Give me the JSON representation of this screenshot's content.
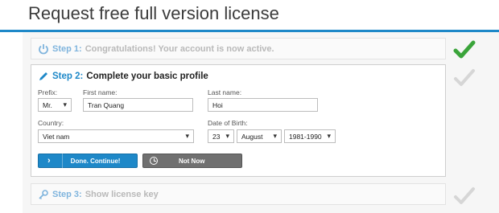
{
  "page": {
    "title": "Request free full version license"
  },
  "step1": {
    "num": "Step 1:",
    "text": "Congratulations! Your account is now active."
  },
  "step2": {
    "num": "Step 2:",
    "text": "Complete your basic profile",
    "prefix": {
      "label": "Prefix:",
      "value": "Mr."
    },
    "first_name": {
      "label": "First name:",
      "value": "Tran Quang"
    },
    "last_name": {
      "label": "Last name:",
      "value": "Hoi"
    },
    "country": {
      "label": "Country:",
      "value": "Viet nam"
    },
    "dob": {
      "label": "Date of Birth:",
      "day": "23",
      "month": "August",
      "range": "1981-1990"
    },
    "done_button": "Done. Continue!",
    "not_now_button": "Not Now"
  },
  "step3": {
    "num": "Step 3:",
    "text": "Show license key"
  },
  "colors": {
    "accent": "#1e88c8",
    "check_done": "#3aa43a",
    "check_pending": "#d6d6d6"
  }
}
